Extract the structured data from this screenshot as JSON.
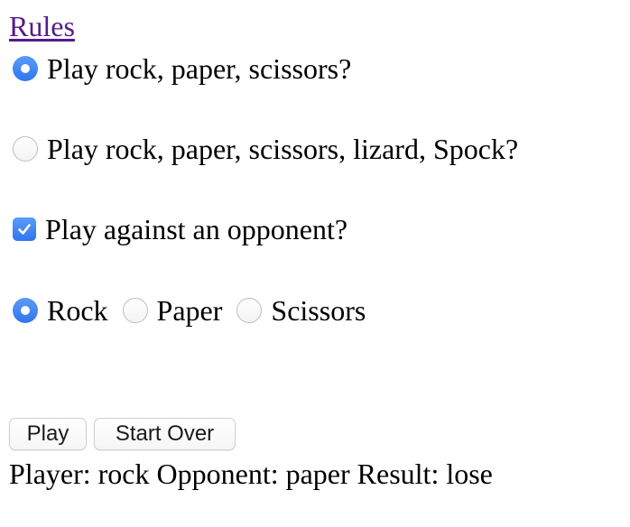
{
  "rules_link": "Rules",
  "modes": [
    {
      "label": "Play rock, paper, scissors?",
      "checked": true
    },
    {
      "label": "Play rock, paper, scissors, lizard, Spock?",
      "checked": false
    }
  ],
  "opponent": {
    "label": "Play against an opponent?",
    "checked": true
  },
  "choices": [
    {
      "label": "Rock",
      "checked": true
    },
    {
      "label": "Paper",
      "checked": false
    },
    {
      "label": "Scissors",
      "checked": false
    }
  ],
  "buttons": {
    "play": "Play",
    "start_over": "Start Over"
  },
  "status": {
    "player": "Player: rock",
    "opponent": "Opponent: paper",
    "result": "Result: lose"
  },
  "colors": {
    "accent": "#3b82f6",
    "link_visited": "#551a8b"
  },
  "icons": {
    "checkmark": "checkmark-icon"
  }
}
